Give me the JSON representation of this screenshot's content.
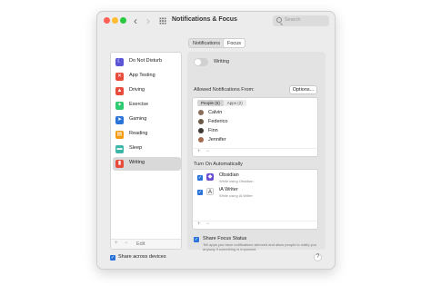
{
  "window": {
    "title": "Notifications & Focus",
    "search_placeholder": "Search"
  },
  "tabs": [
    {
      "label": "Notifications",
      "active": false
    },
    {
      "label": "Focus",
      "active": true
    }
  ],
  "sidebar": {
    "items": [
      {
        "label": "Do Not Disturb",
        "icon": "moon-icon",
        "color": "#5b55d6",
        "glyph": "☾",
        "selected": false
      },
      {
        "label": "App Testing",
        "icon": "grid-x-icon",
        "color": "#e74c3c",
        "glyph": "✕",
        "selected": false
      },
      {
        "label": "Driving",
        "icon": "car-icon",
        "color": "#e74c3c",
        "glyph": "▲",
        "selected": false
      },
      {
        "label": "Exercise",
        "icon": "running-icon",
        "color": "#2ecc71",
        "glyph": "✦",
        "selected": false
      },
      {
        "label": "Gaming",
        "icon": "rocket-icon",
        "color": "#2a74d9",
        "glyph": "➤",
        "selected": false
      },
      {
        "label": "Reading",
        "icon": "book-icon",
        "color": "#f39c12",
        "glyph": "▤",
        "selected": false
      },
      {
        "label": "Sleep",
        "icon": "bed-icon",
        "color": "#3cb6a8",
        "glyph": "▬",
        "selected": false
      },
      {
        "label": "Writing",
        "icon": "document-icon",
        "color": "#e74c3c",
        "glyph": "▮",
        "selected": true
      }
    ],
    "footer": {
      "add": "+",
      "remove": "−",
      "edit": "Edit"
    }
  },
  "detail": {
    "focus_name": "Writing",
    "focus_enabled": false,
    "allowed_title": "Allowed Notifications From:",
    "options_label": "Options...",
    "allowed_tabs": [
      {
        "label": "People (5)",
        "active": true
      },
      {
        "label": "Apps (2)",
        "active": false
      }
    ],
    "people": [
      {
        "name": "Calvin",
        "color": "#8a6d5a"
      },
      {
        "name": "Federico",
        "color": "#6b5a48"
      },
      {
        "name": "Finn",
        "color": "#3d3a36"
      },
      {
        "name": "Jennifer",
        "color": "#a46b52"
      }
    ],
    "people_footer": {
      "add": "+",
      "remove": "−"
    },
    "auto_title": "Turn On Automatically",
    "automations": [
      {
        "name": "Obsidian",
        "subtitle": "While using Obsidian",
        "icon": "obsidian-icon",
        "color": "#6c4fd1",
        "glyph": "◆",
        "checked": true
      },
      {
        "name": "iA Writer",
        "subtitle": "While using iA Writer",
        "icon": "ia-writer-icon",
        "color": "#ffffff",
        "glyph": "A",
        "checked": true
      }
    ],
    "auto_footer": {
      "add": "+",
      "remove": "−"
    },
    "share_status": {
      "checked": true,
      "title": "Share Focus Status",
      "description": "Tell apps you have notifications silenced and allow people to notify you anyway if something is important."
    }
  },
  "bottom": {
    "share_devices": "Share across devices",
    "share_devices_checked": true,
    "help": "?"
  }
}
